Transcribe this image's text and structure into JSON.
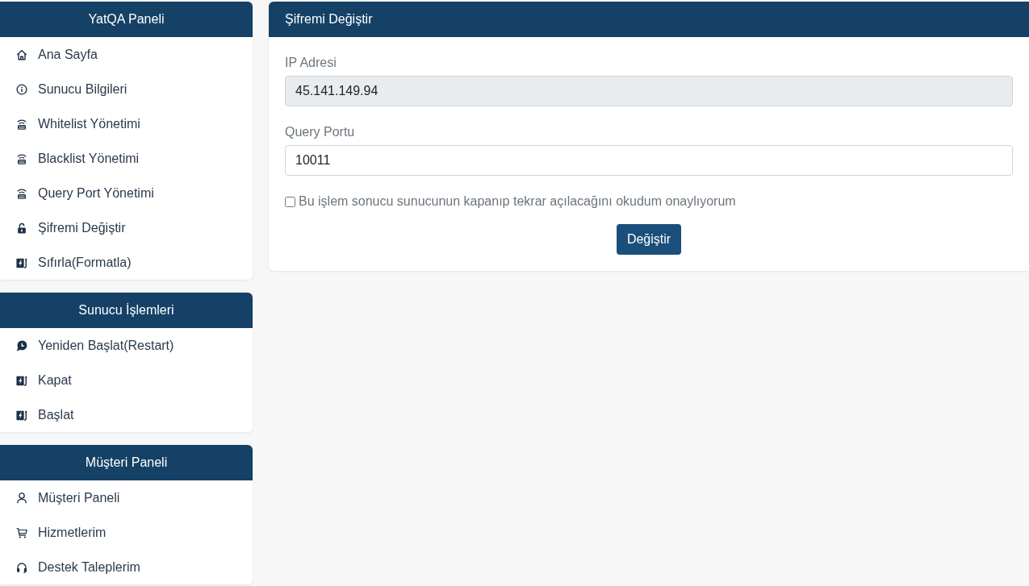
{
  "sidebar": {
    "panels": [
      {
        "title": "YatQA Paneli",
        "items": [
          "Ana Sayfa",
          "Sunucu Bilgileri",
          "Whitelist Yönetimi",
          "Blacklist Yönetimi",
          "Query Port Yönetimi",
          "Şifremi Değiştir",
          "Sıfırla(Formatla)"
        ]
      },
      {
        "title": "Sunucu İşlemleri",
        "items": [
          "Yeniden Başlat(Restart)",
          "Kapat",
          "Başlat"
        ]
      },
      {
        "title": "Müşteri Paneli",
        "items": [
          "Müşteri Paneli",
          "Hizmetlerim",
          "Destek Taleplerim"
        ]
      }
    ]
  },
  "form": {
    "title": "Şifremi Değiştir",
    "fields": [
      {
        "label": "IP Adresi",
        "value": "45.141.149.94",
        "readonly": true
      },
      {
        "label": "Query Portu",
        "value": "10011",
        "readonly": false
      }
    ],
    "confirm": {
      "label": "Bu işlem sonucu sunucunun kapanıp tekrar açılacağını okudum onaylıyorum",
      "checked": false
    },
    "button": "Değiştir"
  }
}
